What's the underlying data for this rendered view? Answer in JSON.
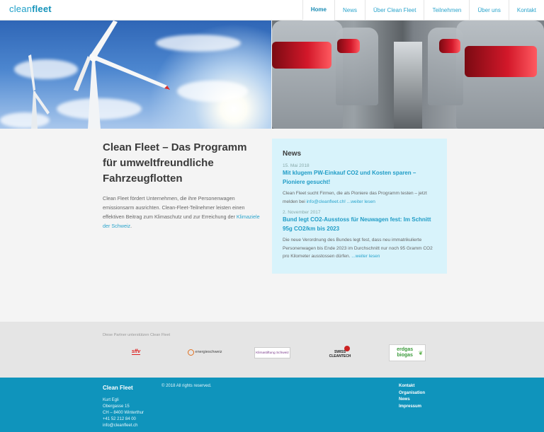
{
  "header": {
    "logo_light": "clean",
    "logo_bold": "fleet",
    "nav": [
      "Home",
      "News",
      "Über Clean Fleet",
      "Teilnehmen",
      "Über uns",
      "Kontakt"
    ]
  },
  "intro": {
    "title": "Clean Fleet – Das Programm für umweltfreundliche Fahrzeugflotten",
    "text": "Clean Fleet fördert Unternehmen, die ihre Personenwagen emissionsarm ausrichten. Clean-Fleet-Teilnehmer leisten einen effektiven Beitrag zum Klimaschutz und zur Erreichung der ",
    "link": "Klimaziele der Schweiz",
    "text_end": "."
  },
  "news": {
    "heading": "News",
    "items": [
      {
        "date": "15. Mai 2018",
        "title": "Mit klugem PW-Einkauf CO2 und Kosten sparen – Pioniere gesucht!",
        "text": "Clean Fleet sucht Firmen, die als Pioniere das Programm testen – jetzt melden bei ",
        "link": "info@cleanfleet.ch!",
        "more": " ...weiter lesen"
      },
      {
        "date": "2. November 2017",
        "title": "Bund legt CO2-Ausstoss für Neuwagen fest: Im Schnitt 95g CO2/km bis 2023",
        "text": "Die neue Verordnung des Bundes legt fest, dass neu immatrikulierte Personenwagen bis Ende 2023 im Durchschnitt nur noch 95 Gramm CO2 pro Kilometer ausstossen dürfen. ",
        "link": "",
        "more": "...weiter lesen"
      }
    ]
  },
  "partners": {
    "label": "Diese Partner unterstützen Clean Fleet",
    "logos": [
      "sffv",
      "energieschweiz",
      "Klimastiftung Schweiz",
      "SWISS CLEANTECH",
      "erdgas biogas"
    ]
  },
  "footer": {
    "brand": "Clean Fleet",
    "address": [
      "Kurt Egli",
      "Obergasse 15",
      "CH – 8400 Winterthur",
      "+41 52 212 84 00",
      "info@cleanfleet.ch"
    ],
    "copyright": "© 2018 All rights reserved.",
    "links": [
      "Kontakt",
      "Organisation",
      "News",
      "Impressum"
    ]
  },
  "colors": {
    "accent": "#1f9cc6",
    "footer_bg": "#0f94bc",
    "news_bg": "#d8f3fb",
    "partners_bg": "#e5e5e5"
  }
}
